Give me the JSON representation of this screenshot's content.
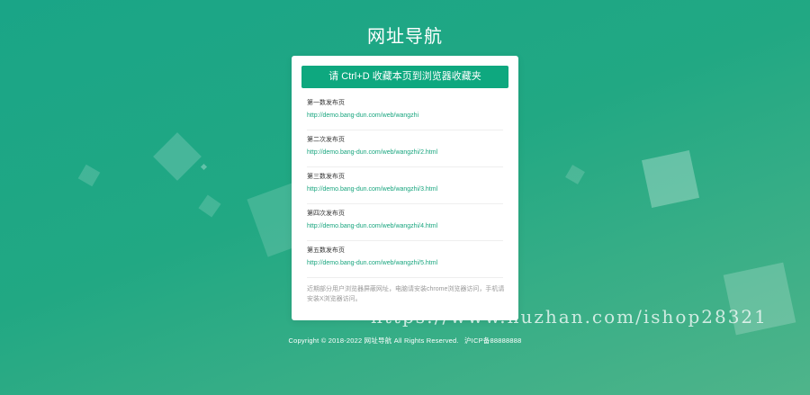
{
  "page": {
    "title": "网址导航"
  },
  "card": {
    "bookmark_button_label": "请 Ctrl+D 收藏本页到浏览器收藏夹",
    "entries": [
      {
        "label": "第一数发布页",
        "url": "http://demo.bang-dun.com/web/wangzhi"
      },
      {
        "label": "第二次发布页",
        "url": "http://demo.bang-dun.com/web/wangzhi/2.html"
      },
      {
        "label": "第三数发布页",
        "url": "http://demo.bang-dun.com/web/wangzhi/3.html"
      },
      {
        "label": "第四次发布页",
        "url": "http://demo.bang-dun.com/web/wangzhi/4.html"
      },
      {
        "label": "第五数发布页",
        "url": "http://demo.bang-dun.com/web/wangzhi/5.html"
      }
    ],
    "note": "近期部分用户浏览器屏蔽网址，电脑请安装chrome浏览器访问，手机请安装X浏览器访问。"
  },
  "footer": {
    "copyright": "Copyright © 2018-2022 网址导航 All Rights Reserved.",
    "icp": "沪ICP备88888888"
  },
  "watermark": {
    "text": "https://www.huzhan.com/ishop28321"
  },
  "colors": {
    "accent": "#0ea87f",
    "link": "#18a57e",
    "background_start": "#1aa587",
    "background_end": "#4fb48a"
  }
}
